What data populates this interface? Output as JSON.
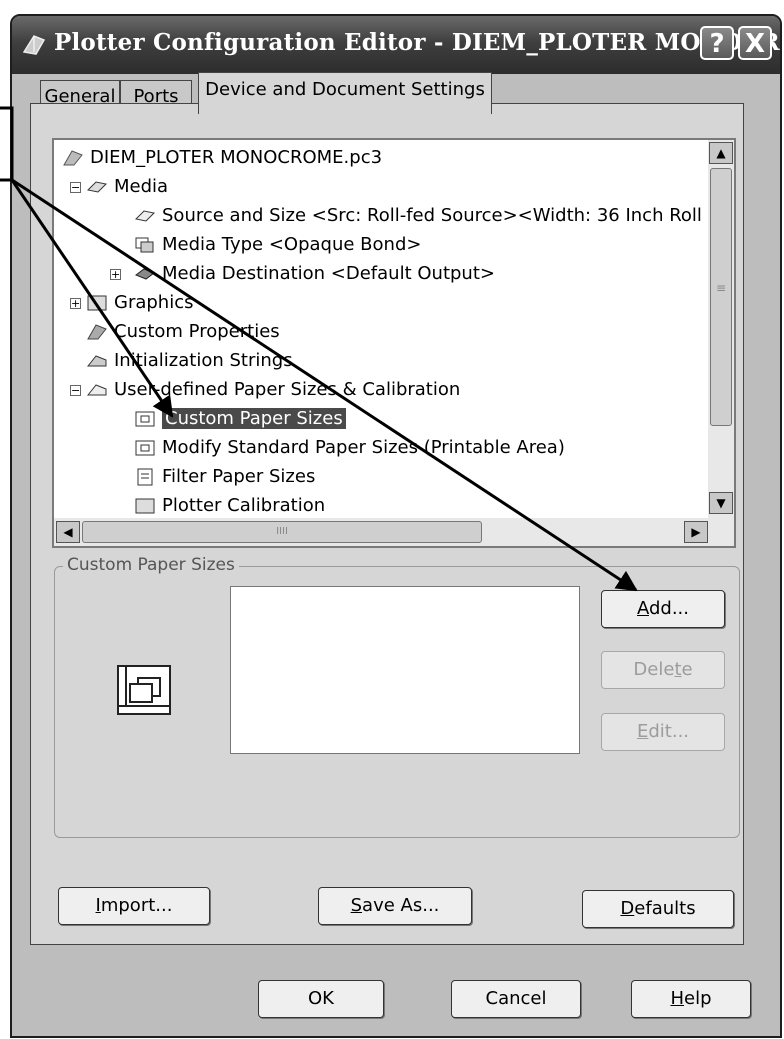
{
  "window": {
    "title": "Plotter Configuration Editor - DIEM_PLOTER MONOCR...",
    "help_glyph": "?",
    "close_glyph": "X"
  },
  "tabs": [
    {
      "label": "General"
    },
    {
      "label": "Ports"
    },
    {
      "label": "Device and Document Settings",
      "active": true
    }
  ],
  "tree": {
    "root": "DIEM_PLOTER MONOCROME.pc3",
    "media": "Media",
    "source_and_size": "Source and Size <Src:  Roll-fed Source><Width: 36 Inch Roll",
    "media_type": "Media Type <Opaque Bond>",
    "media_destination": "Media Destination <Default Output>",
    "graphics": "Graphics",
    "custom_properties": "Custom Properties",
    "initialization_strings": "Initialization Strings",
    "user_defined": "User-defined Paper Sizes & Calibration",
    "custom_paper_sizes": "Custom Paper Sizes",
    "modify_standard": "Modify Standard Paper Sizes (Printable Area)",
    "filter_paper_sizes": "Filter Paper Sizes",
    "plotter_calibration": "Plotter Calibration",
    "hscroll_grip": "IIII",
    "vscroll_grip": "≡"
  },
  "group": {
    "label": "Custom Paper Sizes",
    "add": {
      "pre": "",
      "u": "A",
      "post": "dd..."
    },
    "delete": {
      "pre": "Dele",
      "u": "t",
      "post": "e"
    },
    "edit": {
      "pre": "",
      "u": "E",
      "post": "dit..."
    }
  },
  "bottom": {
    "import": {
      "pre": "",
      "u": "I",
      "post": "mport..."
    },
    "save_as": {
      "pre": "",
      "u": "S",
      "post": "ave As..."
    },
    "defaults": {
      "pre": "",
      "u": "D",
      "post": "efaults"
    }
  },
  "dialog": {
    "ok": "OK",
    "cancel": "Cancel",
    "help": {
      "pre": "",
      "u": "H",
      "post": "elp"
    }
  },
  "colors": {
    "titlebar": "#3f3f3f",
    "selection": "#4a4a4a",
    "face": "#d6d6d6",
    "window_bg": "#bdbdbd"
  }
}
